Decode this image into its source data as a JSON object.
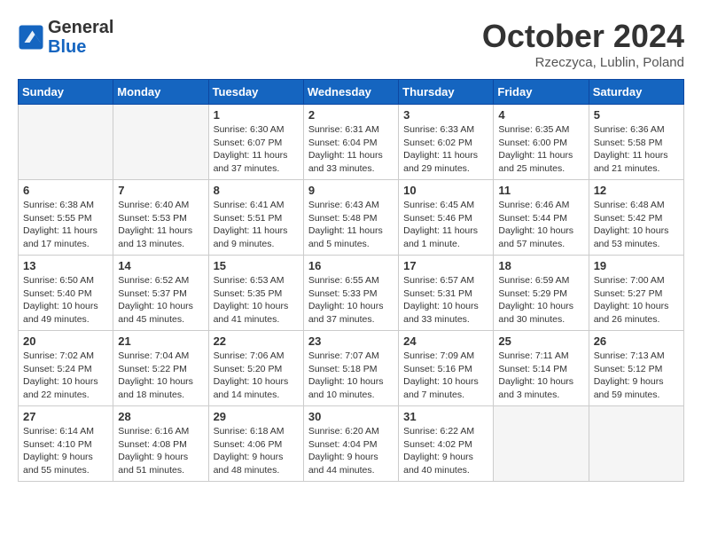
{
  "header": {
    "logo_general": "General",
    "logo_blue": "Blue",
    "month_title": "October 2024",
    "location": "Rzeczyca, Lublin, Poland"
  },
  "days_of_week": [
    "Sunday",
    "Monday",
    "Tuesday",
    "Wednesday",
    "Thursday",
    "Friday",
    "Saturday"
  ],
  "weeks": [
    [
      {
        "num": "",
        "info": ""
      },
      {
        "num": "",
        "info": ""
      },
      {
        "num": "1",
        "info": "Sunrise: 6:30 AM\nSunset: 6:07 PM\nDaylight: 11 hours\nand 37 minutes."
      },
      {
        "num": "2",
        "info": "Sunrise: 6:31 AM\nSunset: 6:04 PM\nDaylight: 11 hours\nand 33 minutes."
      },
      {
        "num": "3",
        "info": "Sunrise: 6:33 AM\nSunset: 6:02 PM\nDaylight: 11 hours\nand 29 minutes."
      },
      {
        "num": "4",
        "info": "Sunrise: 6:35 AM\nSunset: 6:00 PM\nDaylight: 11 hours\nand 25 minutes."
      },
      {
        "num": "5",
        "info": "Sunrise: 6:36 AM\nSunset: 5:58 PM\nDaylight: 11 hours\nand 21 minutes."
      }
    ],
    [
      {
        "num": "6",
        "info": "Sunrise: 6:38 AM\nSunset: 5:55 PM\nDaylight: 11 hours\nand 17 minutes."
      },
      {
        "num": "7",
        "info": "Sunrise: 6:40 AM\nSunset: 5:53 PM\nDaylight: 11 hours\nand 13 minutes."
      },
      {
        "num": "8",
        "info": "Sunrise: 6:41 AM\nSunset: 5:51 PM\nDaylight: 11 hours\nand 9 minutes."
      },
      {
        "num": "9",
        "info": "Sunrise: 6:43 AM\nSunset: 5:48 PM\nDaylight: 11 hours\nand 5 minutes."
      },
      {
        "num": "10",
        "info": "Sunrise: 6:45 AM\nSunset: 5:46 PM\nDaylight: 11 hours\nand 1 minute."
      },
      {
        "num": "11",
        "info": "Sunrise: 6:46 AM\nSunset: 5:44 PM\nDaylight: 10 hours\nand 57 minutes."
      },
      {
        "num": "12",
        "info": "Sunrise: 6:48 AM\nSunset: 5:42 PM\nDaylight: 10 hours\nand 53 minutes."
      }
    ],
    [
      {
        "num": "13",
        "info": "Sunrise: 6:50 AM\nSunset: 5:40 PM\nDaylight: 10 hours\nand 49 minutes."
      },
      {
        "num": "14",
        "info": "Sunrise: 6:52 AM\nSunset: 5:37 PM\nDaylight: 10 hours\nand 45 minutes."
      },
      {
        "num": "15",
        "info": "Sunrise: 6:53 AM\nSunset: 5:35 PM\nDaylight: 10 hours\nand 41 minutes."
      },
      {
        "num": "16",
        "info": "Sunrise: 6:55 AM\nSunset: 5:33 PM\nDaylight: 10 hours\nand 37 minutes."
      },
      {
        "num": "17",
        "info": "Sunrise: 6:57 AM\nSunset: 5:31 PM\nDaylight: 10 hours\nand 33 minutes."
      },
      {
        "num": "18",
        "info": "Sunrise: 6:59 AM\nSunset: 5:29 PM\nDaylight: 10 hours\nand 30 minutes."
      },
      {
        "num": "19",
        "info": "Sunrise: 7:00 AM\nSunset: 5:27 PM\nDaylight: 10 hours\nand 26 minutes."
      }
    ],
    [
      {
        "num": "20",
        "info": "Sunrise: 7:02 AM\nSunset: 5:24 PM\nDaylight: 10 hours\nand 22 minutes."
      },
      {
        "num": "21",
        "info": "Sunrise: 7:04 AM\nSunset: 5:22 PM\nDaylight: 10 hours\nand 18 minutes."
      },
      {
        "num": "22",
        "info": "Sunrise: 7:06 AM\nSunset: 5:20 PM\nDaylight: 10 hours\nand 14 minutes."
      },
      {
        "num": "23",
        "info": "Sunrise: 7:07 AM\nSunset: 5:18 PM\nDaylight: 10 hours\nand 10 minutes."
      },
      {
        "num": "24",
        "info": "Sunrise: 7:09 AM\nSunset: 5:16 PM\nDaylight: 10 hours\nand 7 minutes."
      },
      {
        "num": "25",
        "info": "Sunrise: 7:11 AM\nSunset: 5:14 PM\nDaylight: 10 hours\nand 3 minutes."
      },
      {
        "num": "26",
        "info": "Sunrise: 7:13 AM\nSunset: 5:12 PM\nDaylight: 9 hours\nand 59 minutes."
      }
    ],
    [
      {
        "num": "27",
        "info": "Sunrise: 6:14 AM\nSunset: 4:10 PM\nDaylight: 9 hours\nand 55 minutes."
      },
      {
        "num": "28",
        "info": "Sunrise: 6:16 AM\nSunset: 4:08 PM\nDaylight: 9 hours\nand 51 minutes."
      },
      {
        "num": "29",
        "info": "Sunrise: 6:18 AM\nSunset: 4:06 PM\nDaylight: 9 hours\nand 48 minutes."
      },
      {
        "num": "30",
        "info": "Sunrise: 6:20 AM\nSunset: 4:04 PM\nDaylight: 9 hours\nand 44 minutes."
      },
      {
        "num": "31",
        "info": "Sunrise: 6:22 AM\nSunset: 4:02 PM\nDaylight: 9 hours\nand 40 minutes."
      },
      {
        "num": "",
        "info": ""
      },
      {
        "num": "",
        "info": ""
      }
    ]
  ]
}
